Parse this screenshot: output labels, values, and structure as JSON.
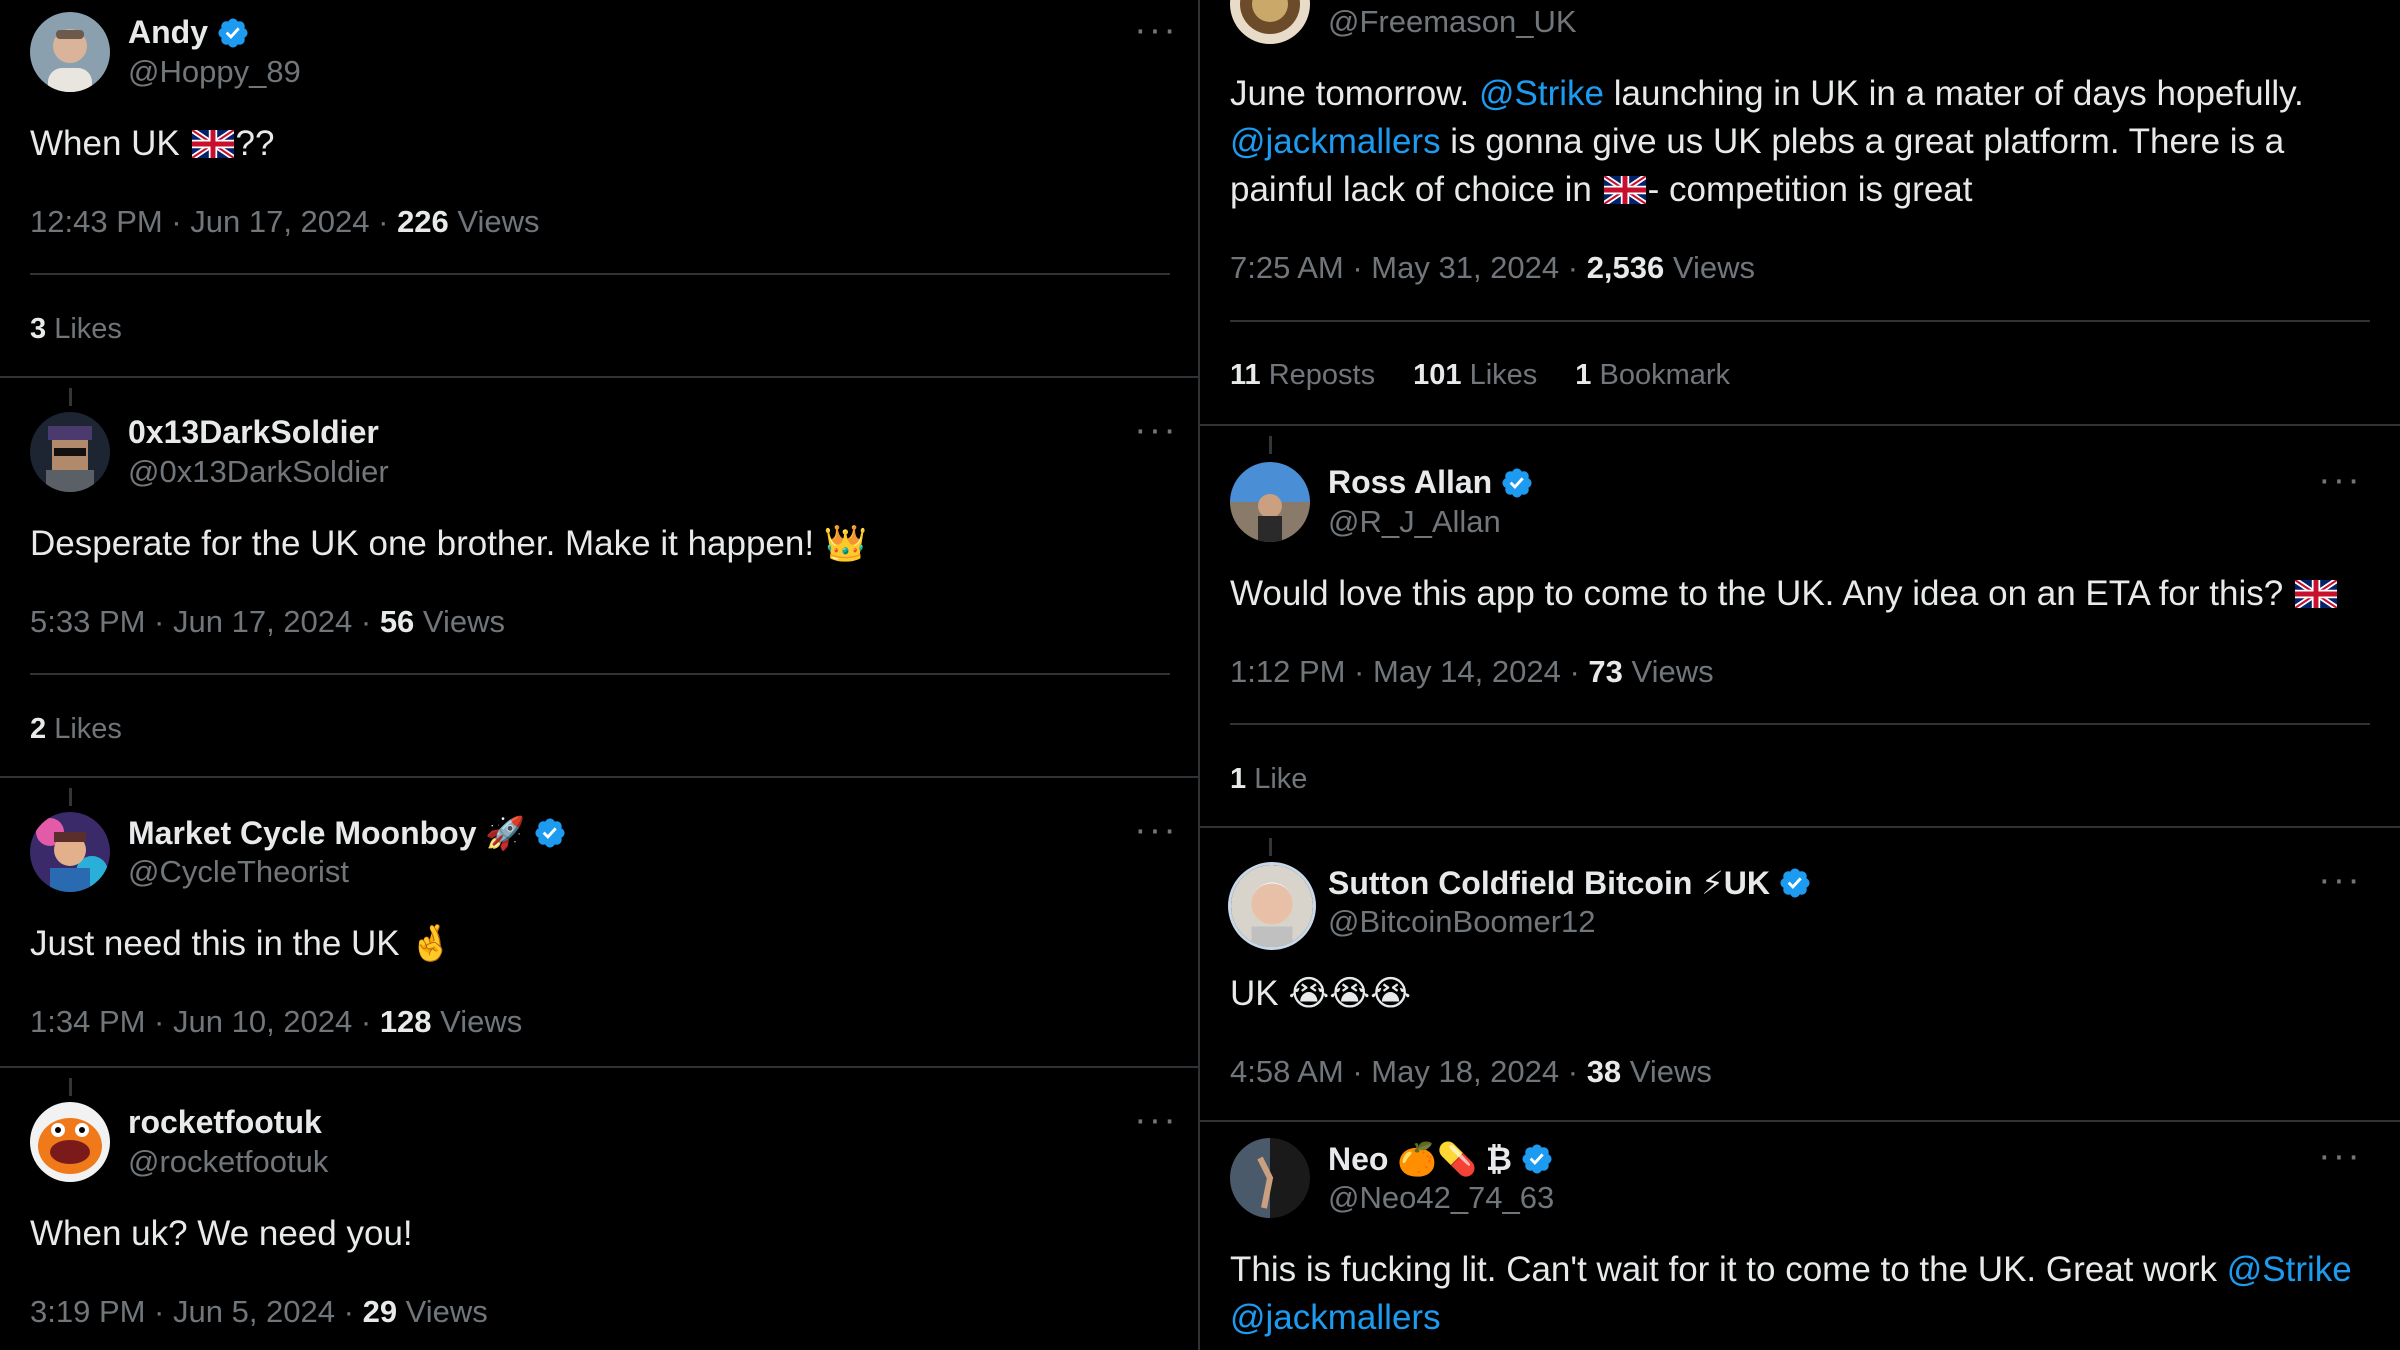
{
  "colors": {
    "background": "#000000",
    "text": "#e7e9ea",
    "muted": "#71767b",
    "link": "#1d9bf0",
    "divider": "#2f3336"
  },
  "left_tweets": [
    {
      "name": "Andy",
      "handle": "@Hoppy_89",
      "verified": true,
      "text": "When UK ",
      "text_after": "??",
      "time": "12:43 PM · Jun 17, 2024 · ",
      "views_count": "226",
      "views_label": " Views",
      "likes_count": "3",
      "likes_label": " Likes"
    },
    {
      "name": "0x13DarkSoldier",
      "handle": "@0x13DarkSoldier",
      "verified": false,
      "text": "Desperate for the UK one brother. Make it happen! 👑",
      "time": "5:33 PM · Jun 17, 2024 · ",
      "views_count": "56",
      "views_label": " Views",
      "likes_count": "2",
      "likes_label": " Likes"
    },
    {
      "name": "Market Cycle Moonboy 🚀",
      "handle": "@CycleTheorist",
      "verified": true,
      "text": "Just need this in the UK 🤞",
      "time": "1:34 PM · Jun 10, 2024 · ",
      "views_count": "128",
      "views_label": " Views"
    },
    {
      "name": "rocketfootuk",
      "handle": "@rocketfootuk",
      "verified": false,
      "text": "When uk? We need you!",
      "time": "3:19 PM · Jun 5, 2024 · ",
      "views_count": "29",
      "views_label": " Views"
    }
  ],
  "right_tweets": [
    {
      "handle": "@Freemason_UK",
      "text_parts": [
        "June tomorrow. ",
        "@Strike",
        " launching in UK in a mater of days hopefully. ",
        "@jackmallers",
        " is gonna give us UK plebs a great platform. There is a painful lack of choice in ",
        "- competition is great"
      ],
      "time": "7:25 AM · May 31, 2024 · ",
      "views_count": "2,536",
      "views_label": " Views",
      "reposts_count": "11",
      "reposts_label": " Reposts",
      "likes_count": "101",
      "likes_label": " Likes",
      "bookmarks_count": "1",
      "bookmarks_label": " Bookmark"
    },
    {
      "name": "Ross Allan",
      "handle": "@R_J_Allan",
      "verified": true,
      "text": "Would love this app to come to the UK. Any idea on an ETA for this? ",
      "time": "1:12 PM · May 14, 2024 · ",
      "views_count": "73",
      "views_label": " Views",
      "likes_count": "1",
      "likes_label": " Like"
    },
    {
      "name": "Sutton Coldfield Bitcoin ⚡UK",
      "handle": "@BitcoinBoomer12",
      "verified": true,
      "text": "UK 😭😭😭",
      "time": "4:58 AM · May 18, 2024 · ",
      "views_count": "38",
      "views_label": " Views"
    },
    {
      "name": "Neo 🍊💊 ₿",
      "handle": "@Neo42_74_63",
      "verified": true,
      "text_parts": [
        "This is fucking lit. Can't wait for it to come to the UK. Great work ",
        "@Strike",
        " ",
        "@jackmallers"
      ]
    }
  ]
}
